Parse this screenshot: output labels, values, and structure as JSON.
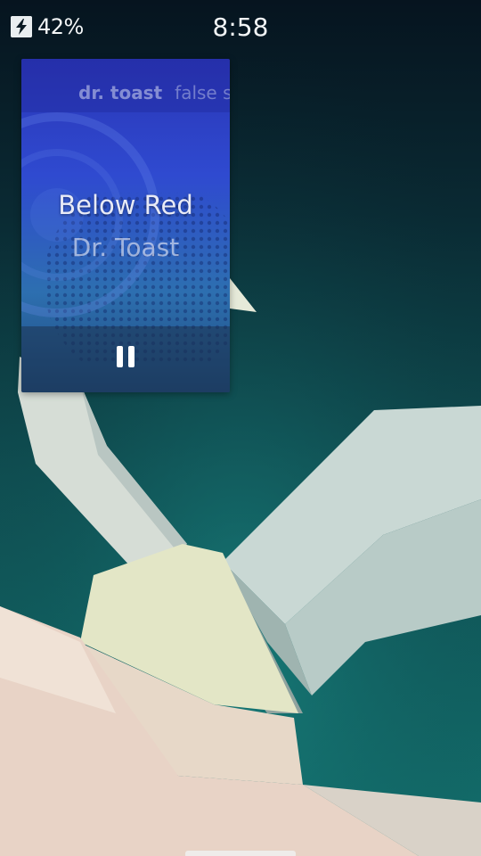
{
  "status_bar": {
    "battery_percent": "42%",
    "charging_icon": "charging-bolt-icon",
    "clock": "8:58"
  },
  "media": {
    "cover_artist": "dr. toast",
    "cover_album": "false su",
    "title": "Below Red",
    "artist": "Dr. Toast",
    "state": "playing",
    "control_icon": "pause-icon"
  },
  "colors": {
    "background_top": "#06141f",
    "background_bottom": "#137672",
    "cover_blue": "#2a3fb8",
    "text": "#f2f5f6"
  }
}
